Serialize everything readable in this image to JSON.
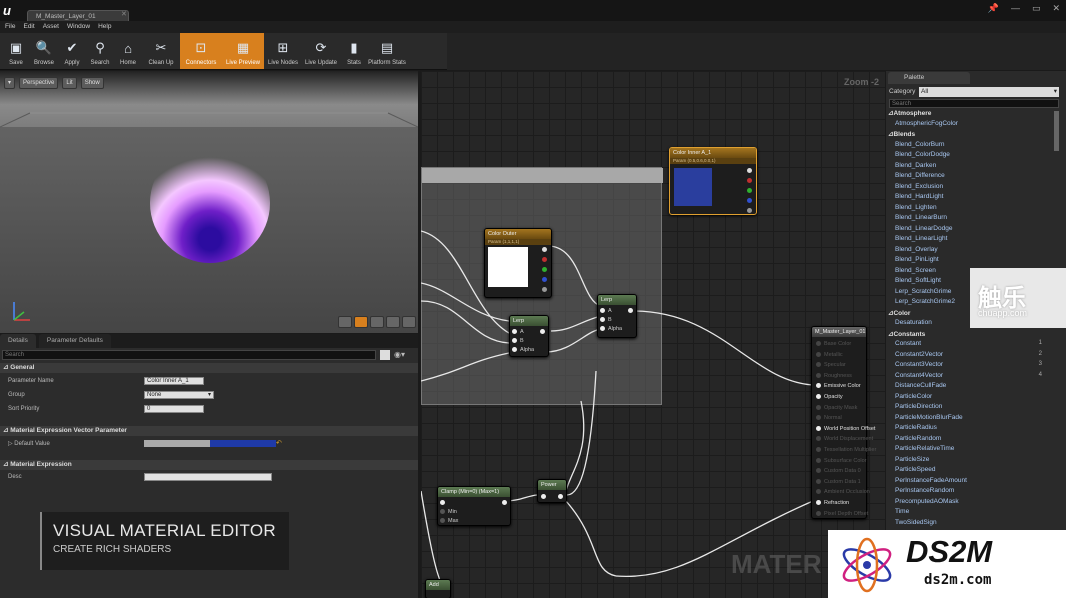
{
  "window": {
    "doc_tab": "M_Master_Layer_01",
    "controls": [
      "📌",
      "—",
      "▭",
      "✕"
    ]
  },
  "menu": [
    "File",
    "Edit",
    "Asset",
    "Window",
    "Help"
  ],
  "toolbar": [
    {
      "label": "Save",
      "icon": "save-icon",
      "glyph": "▣"
    },
    {
      "label": "Browse",
      "icon": "browse-icon",
      "glyph": "🔍"
    },
    {
      "label": "Apply",
      "icon": "apply-icon",
      "glyph": "✔"
    },
    {
      "label": "Search",
      "icon": "search-icon",
      "glyph": "⚲"
    },
    {
      "label": "Home",
      "icon": "home-icon",
      "glyph": "⌂"
    },
    {
      "label": "Clean Up",
      "icon": "cleanup-icon",
      "glyph": "✂"
    },
    {
      "label": "Connectors",
      "icon": "connectors-icon",
      "glyph": "⊡",
      "active": true
    },
    {
      "label": "Live Preview",
      "icon": "live-preview-icon",
      "glyph": "▦",
      "active": true
    },
    {
      "label": "Live Nodes",
      "icon": "live-nodes-icon",
      "glyph": "⊞"
    },
    {
      "label": "Live Update",
      "icon": "live-update-icon",
      "glyph": "⟳"
    },
    {
      "label": "Stats",
      "icon": "stats-icon",
      "glyph": "▮"
    },
    {
      "label": "Platform Stats",
      "icon": "platform-stats-icon",
      "glyph": "▤"
    }
  ],
  "viewport": {
    "perspective": "Perspective",
    "lit": "Lit",
    "show": "Show"
  },
  "details": {
    "tabs": [
      "Details",
      "Parameter Defaults"
    ],
    "search_placeholder": "Search",
    "sections": {
      "general": "General",
      "vector": "Material Expression Vector Parameter",
      "expr": "Material Expression"
    },
    "props": {
      "param_name_label": "Parameter Name",
      "param_name": "Color Inner A_1",
      "group_label": "Group",
      "group": "None",
      "sort_label": "Sort Priority",
      "sort": "0",
      "default_label": "Default Value",
      "desc_label": "Desc"
    }
  },
  "caption": {
    "line1": "VISUAL MATERIAL EDITOR",
    "line2": "CREATE RICH SHADERS"
  },
  "graph": {
    "zoom": "Zoom -2",
    "watermark": "MATER",
    "nodes": {
      "color_inner": {
        "title": "Color Inner A_1",
        "sub": "Param (0.5,0.6,0.0,1)",
        "color": "#2a3e9e"
      },
      "color_outer": {
        "title": "Color Outer",
        "sub": "Param (1,1,1,1)",
        "color": "#ffffff"
      },
      "lerp1": {
        "title": "Lerp",
        "pins": [
          "A",
          "B",
          "Alpha"
        ]
      },
      "lerp2": {
        "title": "Lerp",
        "pins": [
          "A",
          "B",
          "Alpha"
        ]
      },
      "clamp": {
        "title": "Clamp (Min=0) (Max=1)",
        "pins": [
          "Min",
          "Max"
        ]
      },
      "power": {
        "title": "Power"
      },
      "add": {
        "title": "Add"
      },
      "master": {
        "title": "M_Master_Layer_01",
        "pins": [
          "Base Color",
          "Metallic",
          "Specular",
          "Roughness",
          "Emissive Color",
          "Opacity",
          "Opacity Mask",
          "Normal",
          "World Position Offset",
          "World Displacement",
          "Tessellation Multiplier",
          "Subsurface Color",
          "Custom Data 0",
          "Custom Data 1",
          "Ambient Occlusion",
          "Refraction",
          "Pixel Depth Offset"
        ],
        "active": [
          4,
          5,
          8,
          15
        ]
      }
    }
  },
  "palette": {
    "tab": "Palette",
    "category_label": "Category",
    "category": "All",
    "search_placeholder": "Search",
    "items": [
      {
        "t": "c",
        "v": "Atmosphere"
      },
      {
        "t": "i",
        "v": "AtmosphericFogColor"
      },
      {
        "t": "c",
        "v": "Blends"
      },
      {
        "t": "i",
        "v": "Blend_ColorBurn"
      },
      {
        "t": "i",
        "v": "Blend_ColorDodge"
      },
      {
        "t": "i",
        "v": "Blend_Darken"
      },
      {
        "t": "i",
        "v": "Blend_Difference"
      },
      {
        "t": "i",
        "v": "Blend_Exclusion"
      },
      {
        "t": "i",
        "v": "Blend_HardLight"
      },
      {
        "t": "i",
        "v": "Blend_Lighten"
      },
      {
        "t": "i",
        "v": "Blend_LinearBurn"
      },
      {
        "t": "i",
        "v": "Blend_LinearDodge"
      },
      {
        "t": "i",
        "v": "Blend_LinearLight"
      },
      {
        "t": "i",
        "v": "Blend_Overlay"
      },
      {
        "t": "i",
        "v": "Blend_PinLight"
      },
      {
        "t": "i",
        "v": "Blend_Screen"
      },
      {
        "t": "i",
        "v": "Blend_SoftLight"
      },
      {
        "t": "i",
        "v": "Lerp_ScratchGrime"
      },
      {
        "t": "i",
        "v": "Lerp_ScratchGrime2"
      },
      {
        "t": "c",
        "v": "Color"
      },
      {
        "t": "i",
        "v": "Desaturation"
      },
      {
        "t": "c",
        "v": "Constants"
      },
      {
        "t": "i",
        "v": "Constant",
        "n": "1"
      },
      {
        "t": "i",
        "v": "Constant2Vector",
        "n": "2"
      },
      {
        "t": "i",
        "v": "Constant3Vector",
        "n": "3"
      },
      {
        "t": "i",
        "v": "Constant4Vector",
        "n": "4"
      },
      {
        "t": "i",
        "v": "DistanceCullFade"
      },
      {
        "t": "i",
        "v": "ParticleColor"
      },
      {
        "t": "i",
        "v": "ParticleDirection"
      },
      {
        "t": "i",
        "v": "ParticleMotionBlurFade"
      },
      {
        "t": "i",
        "v": "ParticleRadius"
      },
      {
        "t": "i",
        "v": "ParticleRandom"
      },
      {
        "t": "i",
        "v": "ParticleRelativeTime"
      },
      {
        "t": "i",
        "v": "ParticleSize"
      },
      {
        "t": "i",
        "v": "ParticleSpeed"
      },
      {
        "t": "i",
        "v": "PerInstanceFadeAmount"
      },
      {
        "t": "i",
        "v": "PerInstanceRandom"
      },
      {
        "t": "i",
        "v": "PrecomputedAOMask"
      },
      {
        "t": "i",
        "v": "Time"
      },
      {
        "t": "i",
        "v": "TwoSidedSign"
      }
    ]
  },
  "watermarks": {
    "chu_text": "触乐",
    "chu_url": "chuapp.com",
    "ds2m_title": "DS2M",
    "ds2m_url": "ds2m.com"
  }
}
